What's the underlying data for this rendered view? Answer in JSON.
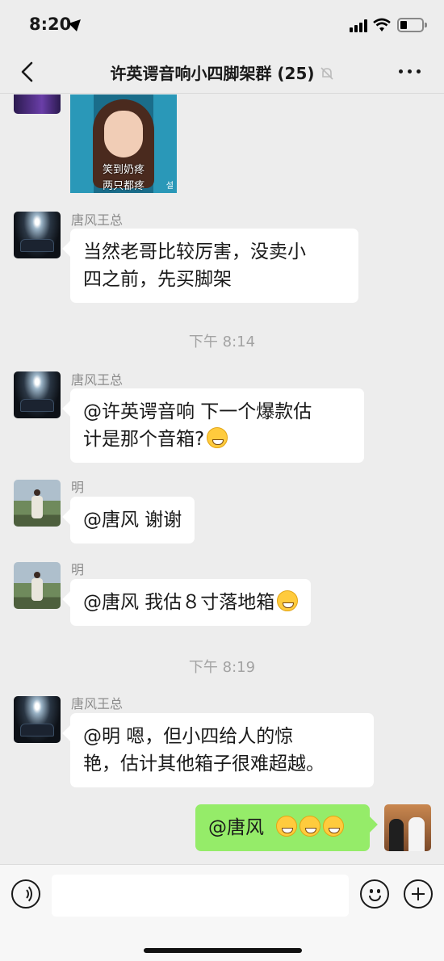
{
  "status_bar": {
    "time": "8:20"
  },
  "nav": {
    "title": "许英谔音响小四脚架群 (25)"
  },
  "sticker": {
    "caption_line1": "笑到奶疼",
    "caption_line2": "两只都疼",
    "watermark": "설"
  },
  "messages": {
    "m1": {
      "sender": "唐风王总",
      "line1": "当然老哥比较厉害，没卖小",
      "line2": "四之前，先买脚架"
    },
    "ts1": "下午 8:14",
    "m2": {
      "sender": "唐风王总",
      "line1": "@许英谔音响 下一个爆款估",
      "line2": "计是那个音箱?"
    },
    "m3": {
      "sender": "明",
      "text": "@唐风 谢谢"
    },
    "m4": {
      "sender": "明",
      "text": "@唐风 我估８寸落地箱"
    },
    "ts2": "下午 8:19",
    "m5": {
      "sender": "唐风王总",
      "line1": "@明 嗯，但小四给人的惊",
      "line2": "艳，估计其他箱子很难超越。"
    },
    "m6": {
      "text": "@唐风"
    }
  },
  "icons": {
    "back": "chevron-left-icon",
    "mute": "bell-slash-icon",
    "more": "more-dots-icon",
    "voice": "voice-icon",
    "emoji": "smiley-icon",
    "add": "plus-icon"
  }
}
